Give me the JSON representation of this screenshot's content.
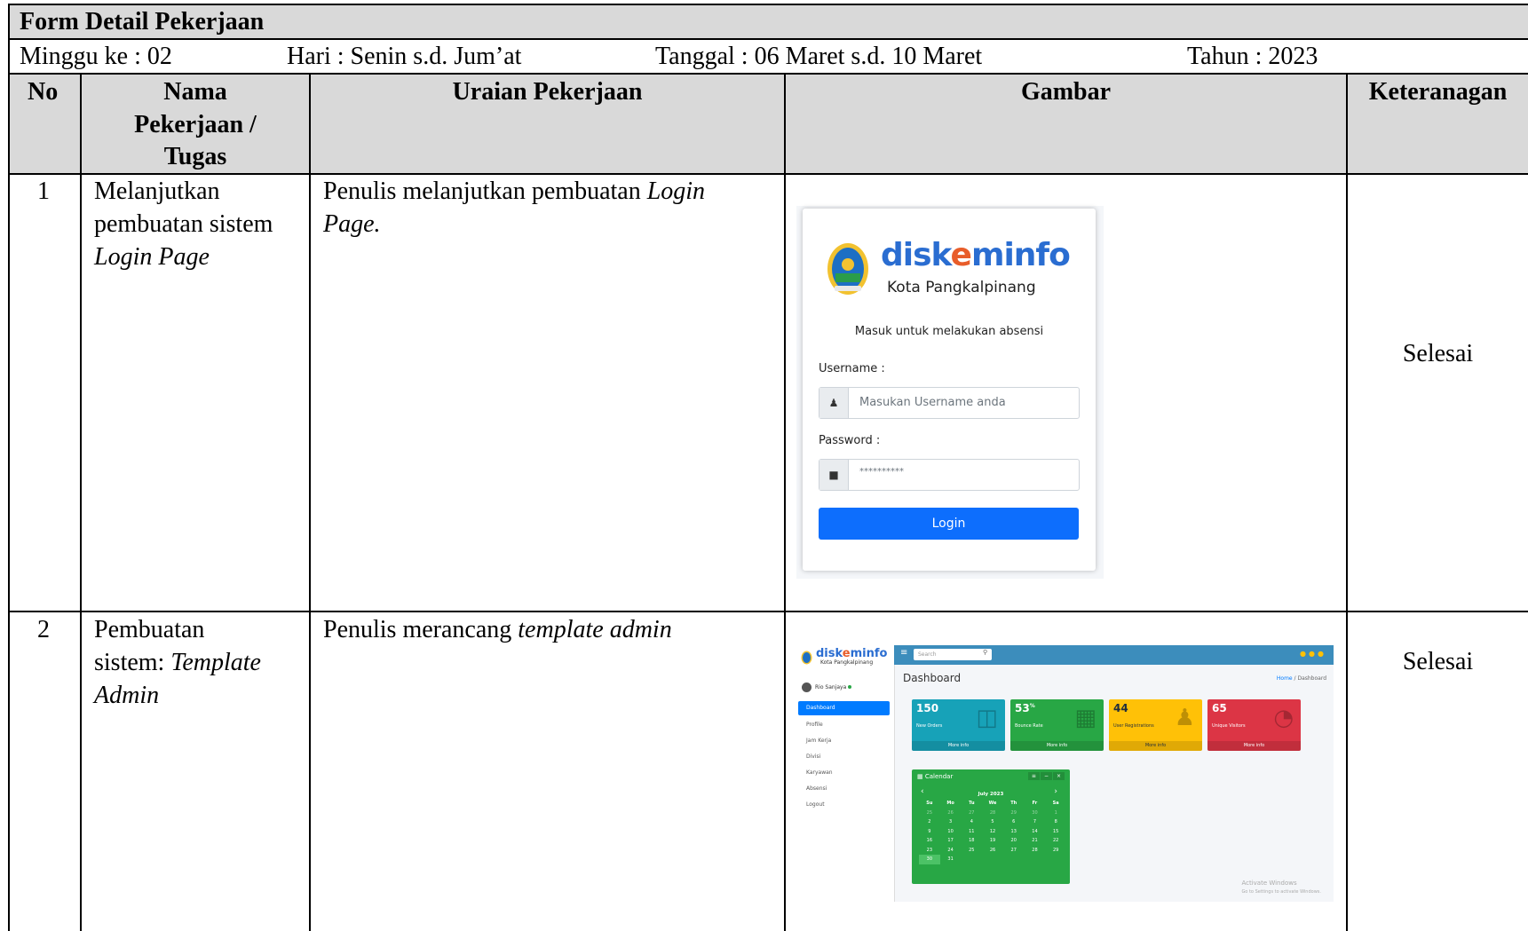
{
  "form_title": "Form Detail Pekerjaan",
  "meta": {
    "minggu": "Minggu ke : 02",
    "hari": "Hari : Senin  s.d. Jum’at",
    "tanggal": "Tanggal :  06 Maret s.d. 10 Maret",
    "tahun": "Tahun : 2023"
  },
  "columns": {
    "no": "No",
    "nama_1": "Nama",
    "nama_2": "Pekerjaan /",
    "nama_3": "Tugas",
    "uraian": "Uraian Pekerjaan",
    "gambar": "Gambar",
    "keterangan": "Keteranagan"
  },
  "rows": [
    {
      "no": "1",
      "nama_1": "Melanjutkan",
      "nama_2": "pembuatan sistem",
      "nama_3_italic": "Login Page",
      "uraian_1a": "Penulis melanjutkan pembuatan ",
      "uraian_1b_italic": "Login",
      "uraian_2_italic": "Page.",
      "keterangan": "Selesai"
    },
    {
      "no": "2",
      "nama_1": "Pembuatan",
      "nama_2a": "sistem:  ",
      "nama_2b_italic": "Template",
      "nama_3_italic": "Admin",
      "uraian_a": "Penulis merancang ",
      "uraian_b_italic": "template admin",
      "keterangan": "Selesai"
    }
  ],
  "login_screenshot": {
    "brand_a": "disk",
    "brand_b": "e",
    "brand_c": "minfo",
    "brand_sub": "Kota Pangkalpinang",
    "message": "Masuk untuk melakukan absensi",
    "username_label": "Username :",
    "username_placeholder": "Masukan Username anda",
    "password_label": "Password :",
    "password_value": "**********",
    "button": "Login"
  },
  "admin_screenshot": {
    "brand_a": "disk",
    "brand_b": "e",
    "brand_c": "minfo",
    "brand_sub": "Kota Pangkalpinang",
    "user": "Rio Sanjaya",
    "search_placeholder": "Search",
    "nav": [
      "Dashboard",
      "Profile",
      "Jam Kerja",
      "Divisi",
      "Karyawan",
      "Absensi",
      "Logout"
    ],
    "page_title": "Dashboard",
    "crumb_home": "Home",
    "crumb_current": " / Dashboard",
    "boxes": [
      {
        "value": "150",
        "suffix": "",
        "label": "New Orders",
        "color": "#17a2b8"
      },
      {
        "value": "53",
        "suffix": "%",
        "label": "Bounce Rate",
        "color": "#28a745"
      },
      {
        "value": "44",
        "suffix": "",
        "label": "User Registrations",
        "color": "#ffc107"
      },
      {
        "value": "65",
        "suffix": "",
        "label": "Unique Visitors",
        "color": "#dc3545"
      }
    ],
    "more_info": "More info",
    "calendar": {
      "title": "Calendar",
      "month": "July 2023",
      "days": [
        "Su",
        "Mo",
        "Tu",
        "We",
        "Th",
        "Fr",
        "Sa"
      ],
      "weeks": [
        [
          "25",
          "26",
          "27",
          "28",
          "29",
          "30",
          "1"
        ],
        [
          "2",
          "3",
          "4",
          "5",
          "6",
          "7",
          "8"
        ],
        [
          "9",
          "10",
          "11",
          "12",
          "13",
          "14",
          "15"
        ],
        [
          "16",
          "17",
          "18",
          "19",
          "20",
          "21",
          "22"
        ],
        [
          "23",
          "24",
          "25",
          "26",
          "27",
          "28",
          "29"
        ],
        [
          "30",
          "31",
          "",
          "",
          "",
          "",
          ""
        ]
      ]
    },
    "activate_1": "Activate Windows",
    "activate_2": "Go to Settings to activate Windows."
  }
}
